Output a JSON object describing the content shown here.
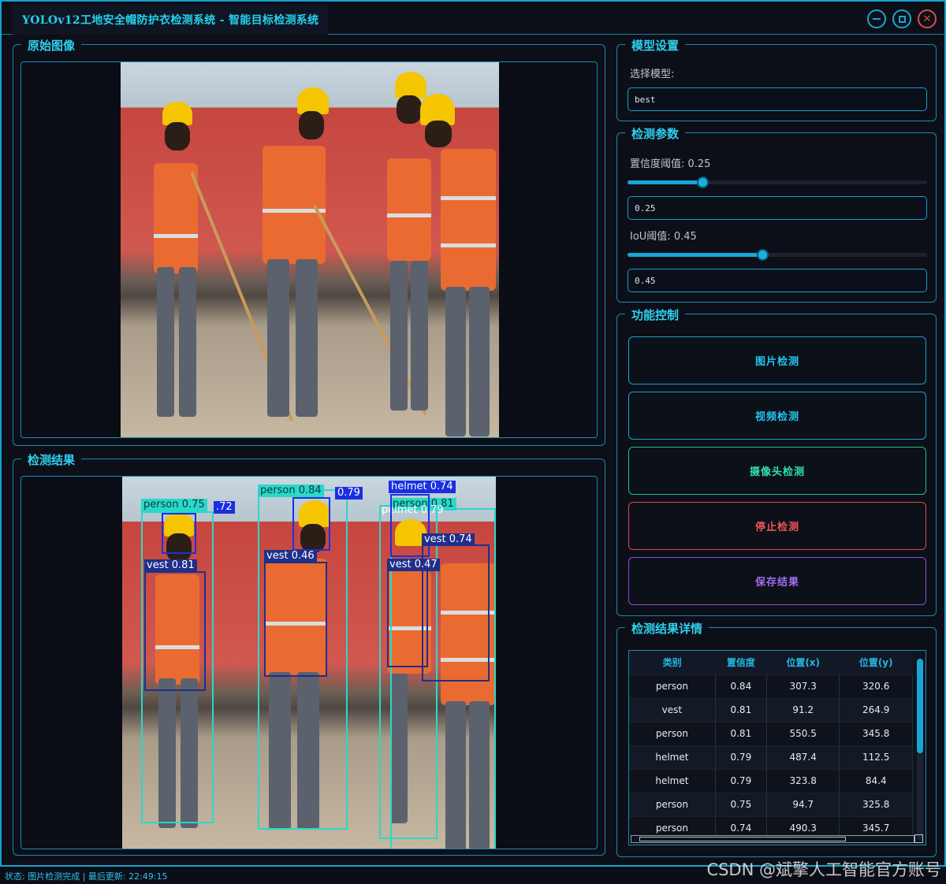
{
  "window": {
    "title": "YOLOv12工地安全帽防护衣检测系统 - 智能目标检测系统"
  },
  "groups": {
    "original": "原始图像",
    "result": "检测结果",
    "model": "模型设置",
    "params": "检测参数",
    "control": "功能控制",
    "details": "检测结果详情"
  },
  "model": {
    "select_label": "选择模型:",
    "selected": "best"
  },
  "params": {
    "conf_label": "置信度阈值: 0.25",
    "conf_value": "0.25",
    "conf_fraction": 0.25,
    "iou_label": "IoU阈值: 0.45",
    "iou_value": "0.45",
    "iou_fraction": 0.45
  },
  "buttons": {
    "image_detect": "图片检测",
    "video_detect": "视频检测",
    "camera_detect": "摄像头检测",
    "stop_detect": "停止检测",
    "save_result": "保存结果"
  },
  "colors": {
    "accent": "#1aa6d4",
    "image_btn": "#1b9fd0",
    "video_btn": "#1b9fd0",
    "camera_btn": "#1fbf92",
    "stop_btn": "#e04a4a",
    "save_btn": "#8a4fd8",
    "person_box": "#2ad8c9",
    "helmet_box": "#1a2fe0",
    "vest_box": "#1f2f8a"
  },
  "table": {
    "headers": [
      "类别",
      "置信度",
      "位置(x)",
      "位置(y)"
    ],
    "rows": [
      [
        "person",
        "0.84",
        "307.3",
        "320.6"
      ],
      [
        "vest",
        "0.81",
        "91.2",
        "264.9"
      ],
      [
        "person",
        "0.81",
        "550.5",
        "345.8"
      ],
      [
        "helmet",
        "0.79",
        "487.4",
        "112.5"
      ],
      [
        "helmet",
        "0.79",
        "323.8",
        "84.4"
      ],
      [
        "person",
        "0.75",
        "94.7",
        "325.8"
      ],
      [
        "person",
        "0.74",
        "490.3",
        "345.7"
      ]
    ]
  },
  "detections": {
    "l1": "person 0.75",
    "l2": ".72",
    "l3": "vest 0.81",
    "l4": "person 0.84",
    "l5": "0.79",
    "l6": "vest 0.46",
    "l7": "helmet 0.74",
    "l8": "person 0.81",
    "l9": "pelmet 0.79",
    "l10": "vest 0.74",
    "l11": "vest 0.47"
  },
  "status": "状态: 图片检测完成 | 最后更新: 22:49:15",
  "watermark": "CSDN @斌擎人工智能官方账号"
}
